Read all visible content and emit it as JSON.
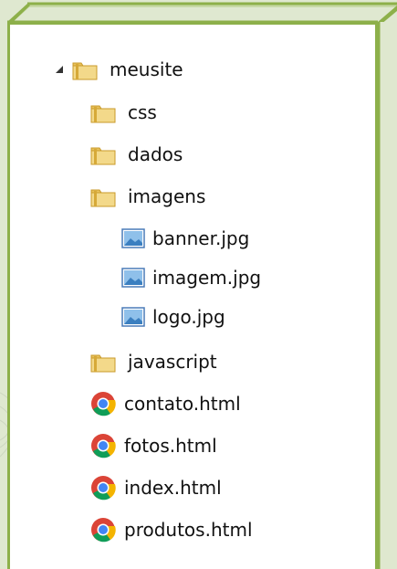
{
  "explorer": {
    "root": {
      "label": "meusite",
      "expanded": true
    },
    "items": [
      {
        "type": "folder",
        "label": "css"
      },
      {
        "type": "folder",
        "label": "dados"
      },
      {
        "type": "folder",
        "label": "imagens",
        "expanded": true,
        "children": [
          {
            "type": "image",
            "label": "banner.jpg"
          },
          {
            "type": "image",
            "label": "imagem.jpg"
          },
          {
            "type": "image",
            "label": "logo.jpg"
          }
        ]
      },
      {
        "type": "folder",
        "label": "javascript"
      },
      {
        "type": "html",
        "label": "contato.html"
      },
      {
        "type": "html",
        "label": "fotos.html"
      },
      {
        "type": "html",
        "label": "index.html"
      },
      {
        "type": "html",
        "label": "produtos.html"
      }
    ]
  },
  "colors": {
    "frame_border": "#8db04a",
    "background": "#dfe8d0",
    "panel": "#ffffff",
    "folder": "#e8c25c"
  },
  "icons": {
    "expand_arrow": "expanded-triangle-icon",
    "folder": "folder-icon",
    "image": "image-file-icon",
    "html": "chrome-html-file-icon"
  }
}
